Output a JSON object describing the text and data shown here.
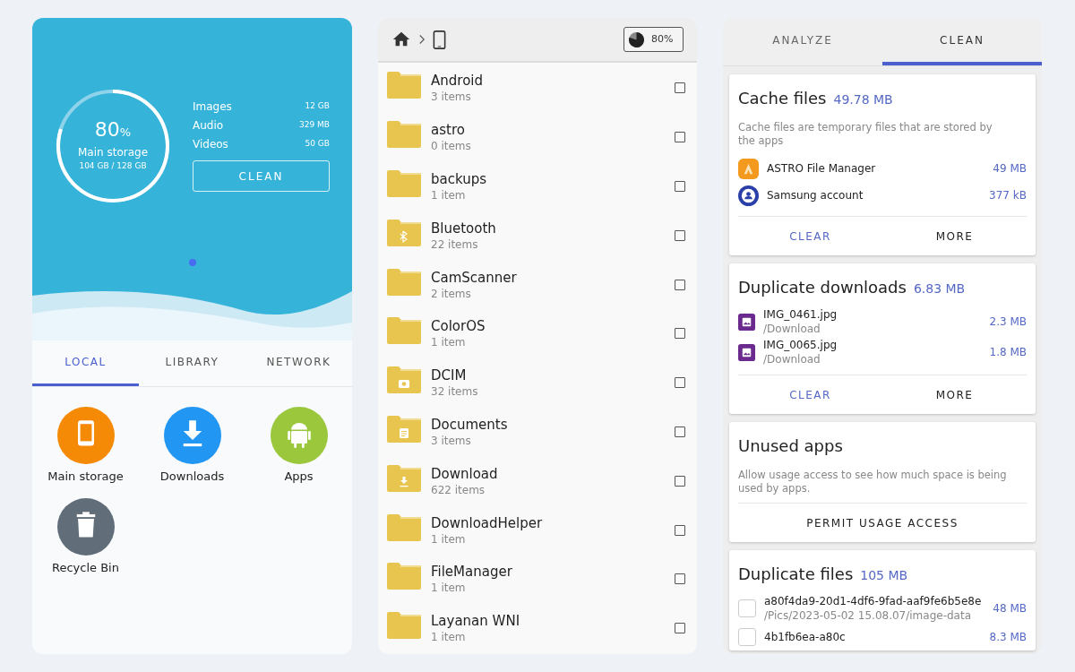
{
  "home": {
    "storage": {
      "percent": "80",
      "percent_sign": "%",
      "label": "Main storage",
      "usage": "104 GB / 128 GB"
    },
    "categories": [
      {
        "name": "Images",
        "size": "12 GB"
      },
      {
        "name": "Audio",
        "size": "329 MB"
      },
      {
        "name": "Videos",
        "size": "50 GB"
      }
    ],
    "clean_button": "CLEAN",
    "tabs": [
      {
        "label": "LOCAL",
        "selected": true
      },
      {
        "label": "LIBRARY",
        "selected": false
      },
      {
        "label": "NETWORK",
        "selected": false
      }
    ],
    "shortcuts": [
      {
        "label": "Main storage",
        "kind": "phone",
        "color": "#f58a07"
      },
      {
        "label": "Downloads",
        "kind": "download",
        "color": "#2196f3"
      },
      {
        "label": "Apps",
        "kind": "android",
        "color": "#9ac73c"
      },
      {
        "label": "Recycle Bin",
        "kind": "trash",
        "color": "#616e79"
      }
    ]
  },
  "browser": {
    "usage_badge": "80%",
    "folders": [
      {
        "name": "Android",
        "count": "3 items",
        "kind": "plain",
        "checked": false
      },
      {
        "name": "astro",
        "count": "0 items",
        "kind": "plain",
        "checked": false
      },
      {
        "name": "backups",
        "count": "1 item",
        "kind": "plain",
        "checked": false
      },
      {
        "name": "Bluetooth",
        "count": "22 items",
        "kind": "bluetooth",
        "checked": false
      },
      {
        "name": "CamScanner",
        "count": "2 items",
        "kind": "plain",
        "checked": false
      },
      {
        "name": "ColorOS",
        "count": "1 item",
        "kind": "plain",
        "checked": false
      },
      {
        "name": "DCIM",
        "count": "32 items",
        "kind": "camera",
        "checked": false
      },
      {
        "name": "Documents",
        "count": "3 items",
        "kind": "document",
        "checked": false
      },
      {
        "name": "Download",
        "count": "622 items",
        "kind": "download",
        "checked": false
      },
      {
        "name": "DownloadHelper",
        "count": "1 item",
        "kind": "plain",
        "checked": false
      },
      {
        "name": "FileManager",
        "count": "1 item",
        "kind": "plain",
        "checked": false
      },
      {
        "name": "Layanan WNI",
        "count": "1 item",
        "kind": "plain",
        "checked": false
      }
    ]
  },
  "cleaner": {
    "tabs": [
      {
        "label": "ANALYZE",
        "selected": false
      },
      {
        "label": "CLEAN",
        "selected": true
      }
    ],
    "cards": [
      {
        "title": "Cache files",
        "size": "49.78 MB",
        "description": "Cache files are temporary files that are stored by the apps",
        "items": [
          {
            "kind": "astro",
            "name": "ASTRO File Manager",
            "size": "49 MB"
          },
          {
            "kind": "account",
            "name": "Samsung account",
            "size": "377 kB"
          }
        ],
        "actions": [
          "CLEAR",
          "MORE"
        ]
      },
      {
        "title": "Duplicate downloads",
        "size": "6.83 MB",
        "items": [
          {
            "kind": "image",
            "name": "IMG_0461.jpg",
            "path": "/Download",
            "size": "2.3 MB"
          },
          {
            "kind": "image",
            "name": "IMG_0065.jpg",
            "path": "/Download",
            "size": "1.8 MB"
          }
        ],
        "actions": [
          "CLEAR",
          "MORE"
        ]
      },
      {
        "title": "Unused apps",
        "description": "Allow usage access to see how much space is being used by apps.",
        "actions": [
          "PERMIT USAGE ACCESS"
        ]
      },
      {
        "title": "Duplicate files",
        "size": "105 MB",
        "items": [
          {
            "kind": "checkbox",
            "checked": false,
            "name": "a80f4da9-20d1-4df6-9fad-aaf9fe6b5e8e",
            "path": "/Pics/2023-05-02 15.08.07/image-data",
            "size": "48 MB"
          },
          {
            "kind": "checkbox",
            "checked": false,
            "name": "4b1fb6ea-a80c",
            "size": "8.3 MB"
          }
        ]
      }
    ]
  }
}
